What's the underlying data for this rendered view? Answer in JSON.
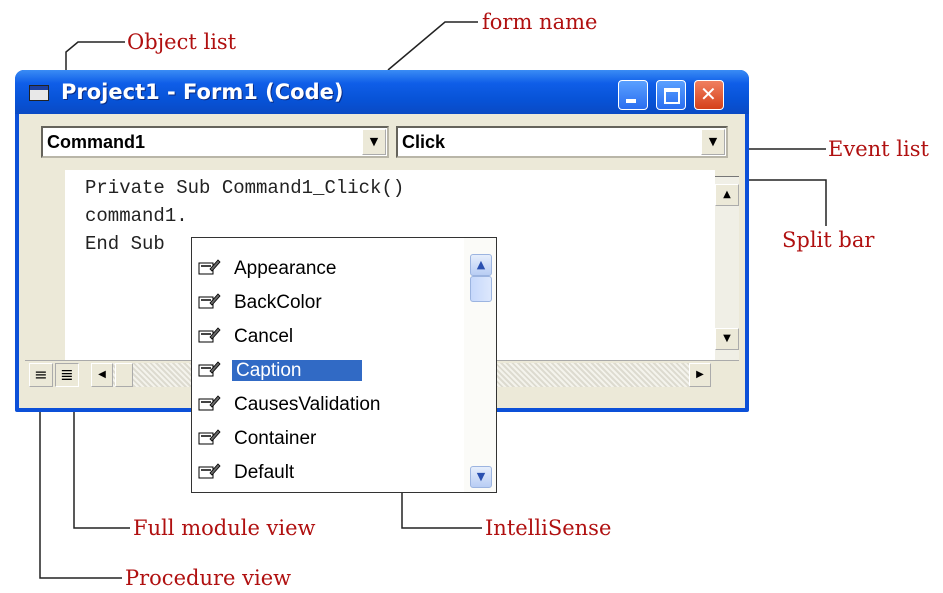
{
  "annotations": {
    "object_list": "Object list",
    "form_name": "form name",
    "event_list": "Event list",
    "split_bar": "Split bar",
    "full_module_view": "Full module view",
    "intellisense": "IntelliSense",
    "procedure_view": "Procedure view"
  },
  "window": {
    "title": "Project1 - Form1 (Code)"
  },
  "object_combo": {
    "value": "Command1"
  },
  "event_combo": {
    "value": "Click"
  },
  "code_lines": [
    "Private Sub Command1_Click()",
    "command1.",
    "End Sub"
  ],
  "intellisense": {
    "items": [
      "Appearance",
      "BackColor",
      "Cancel",
      "Caption",
      "CausesValidation",
      "Container",
      "Default"
    ],
    "selected": "Caption"
  },
  "colors": {
    "annotation": "#b01010",
    "title_bar": "#0752d6",
    "selection": "#316ac5"
  }
}
